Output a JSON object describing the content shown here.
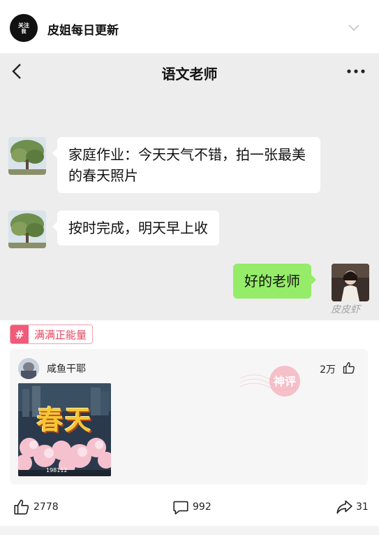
{
  "post": {
    "author_avatar_line1": "关注",
    "author_avatar_line2": "我",
    "author_name": "皮姐每日更新",
    "collapse_icon": "chevron-down-icon"
  },
  "chat": {
    "title": "语文老师",
    "back_icon": "back-arrow-icon",
    "more_icon": "more-dots-icon",
    "messages": [
      {
        "sender": "teacher",
        "text": "家庭作业：今天天气不错，拍一张最美的春天照片"
      },
      {
        "sender": "teacher",
        "text": "按时完成，明天早上收"
      },
      {
        "sender": "me",
        "text": "好的老师"
      }
    ],
    "watermark": "皮皮虾",
    "bubble_color_me": "#95ec69",
    "background": "#ededed"
  },
  "tag": {
    "icon": "#",
    "label": "满满正能量",
    "color": "#f15a78"
  },
  "comment": {
    "user": "咸鱼干耶",
    "likes": "2万",
    "stamp": "神评",
    "image_title": "春天",
    "image_score": "198112"
  },
  "actions": {
    "likes": "2778",
    "comments": "992",
    "shares": "31"
  }
}
